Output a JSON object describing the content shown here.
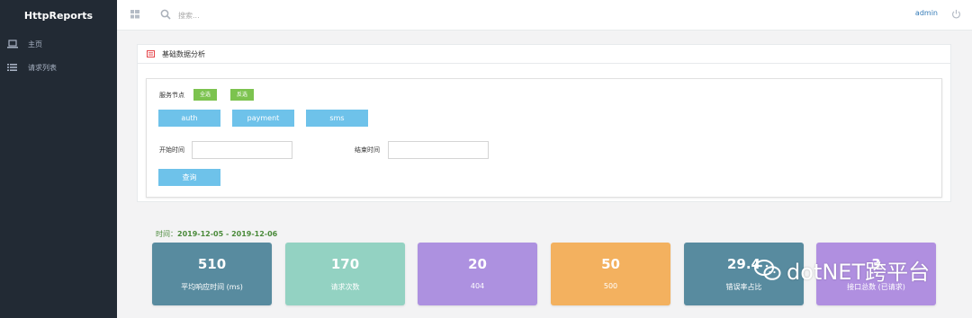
{
  "app": {
    "name": "HttpReports"
  },
  "sidebar": {
    "items": [
      {
        "label": "主页",
        "icon": "laptop-icon"
      },
      {
        "label": "请求列表",
        "icon": "list-icon"
      }
    ]
  },
  "topbar": {
    "search_placeholder": "搜索...",
    "user": "admin"
  },
  "panel": {
    "title": "基础数据分析",
    "service_label": "服务节点",
    "select_all": "全选",
    "invert_select": "反选",
    "services": [
      "auth",
      "payment",
      "sms"
    ],
    "start_label": "开始时间",
    "end_label": "结束时间",
    "query_button": "查询"
  },
  "range": {
    "label": "时间：",
    "value": "2019-12-05 - 2019-12-06"
  },
  "cards": [
    {
      "value": "510",
      "caption": "平均响应时间 (ms)",
      "color": "#588b9f"
    },
    {
      "value": "170",
      "caption": "请求次数",
      "color": "#93d2c2"
    },
    {
      "value": "20",
      "caption": "404",
      "color": "#ad91e0"
    },
    {
      "value": "50",
      "caption": "500",
      "color": "#f3b15f"
    },
    {
      "value": "29.4",
      "caption": "错误率占比",
      "color": "#588b9f"
    },
    {
      "value": "3",
      "caption": "接口总数 (已请求)",
      "color": "#b08fe0"
    }
  ],
  "watermark": {
    "text": "dotNET跨平台"
  }
}
